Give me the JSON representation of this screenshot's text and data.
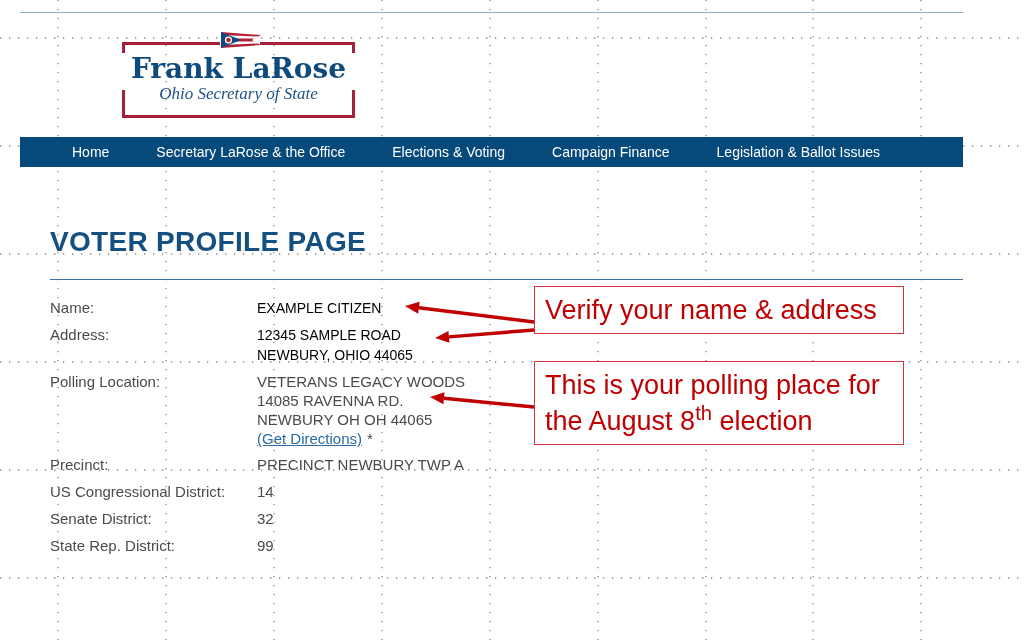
{
  "header": {
    "logo_title": "Frank LaRose",
    "logo_subtitle": "Ohio Secretary of State"
  },
  "nav": {
    "items": [
      "Home",
      "Secretary LaRose & the Office",
      "Elections & Voting",
      "Campaign Finance",
      "Legislation & Ballot Issues"
    ]
  },
  "page_title": "VOTER PROFILE PAGE",
  "profile": {
    "rows": [
      {
        "label": "Name:",
        "kind": "example",
        "lines": [
          "EXAMPLE CITIZEN"
        ]
      },
      {
        "label": "Address:",
        "kind": "example",
        "lines": [
          "12345 SAMPLE ROAD",
          "NEWBURY, OHIO 44065"
        ]
      },
      {
        "label": "Polling Location:",
        "kind": "plain",
        "lines": [
          "VETERANS LEGACY WOODS",
          "14085 RAVENNA RD.",
          "NEWBURY OH OH 44065"
        ],
        "link": "(Get Directions)",
        "note": "*"
      },
      {
        "label": "Precinct:",
        "kind": "plain",
        "lines": [
          "PRECINCT NEWBURY TWP A"
        ]
      },
      {
        "label": "US Congressional District:",
        "kind": "plain",
        "lines": [
          "14"
        ]
      },
      {
        "label": "Senate District:",
        "kind": "plain",
        "lines": [
          "32"
        ]
      },
      {
        "label": "State Rep. District:",
        "kind": "plain",
        "lines": [
          "99"
        ]
      }
    ]
  },
  "callouts": [
    {
      "text": "Verify your name & address"
    },
    {
      "text": "This is your polling place for the August 8$^{th}$ election"
    }
  ]
}
